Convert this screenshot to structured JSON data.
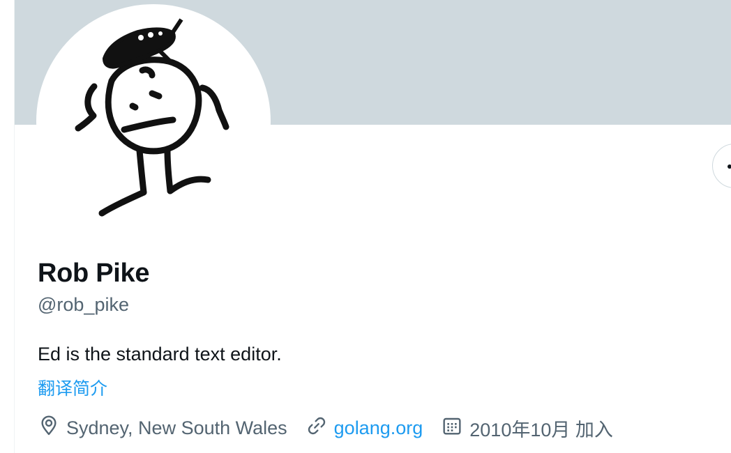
{
  "profile": {
    "display_name": "Rob Pike",
    "handle": "@rob_pike",
    "bio": "Ed is the standard text editor.",
    "translate_label": "翻译简介",
    "location": "Sydney, New South Wales",
    "website": "golang.org",
    "joined": "2010年10月 加入"
  },
  "icons": {
    "location": "location-pin-icon",
    "website": "link-icon",
    "joined": "calendar-icon",
    "more": "more-dots-icon"
  },
  "colors": {
    "banner": "#cfd9de",
    "accent": "#1d9bf0",
    "primary_text": "#0f1419",
    "secondary_text": "#536471"
  }
}
